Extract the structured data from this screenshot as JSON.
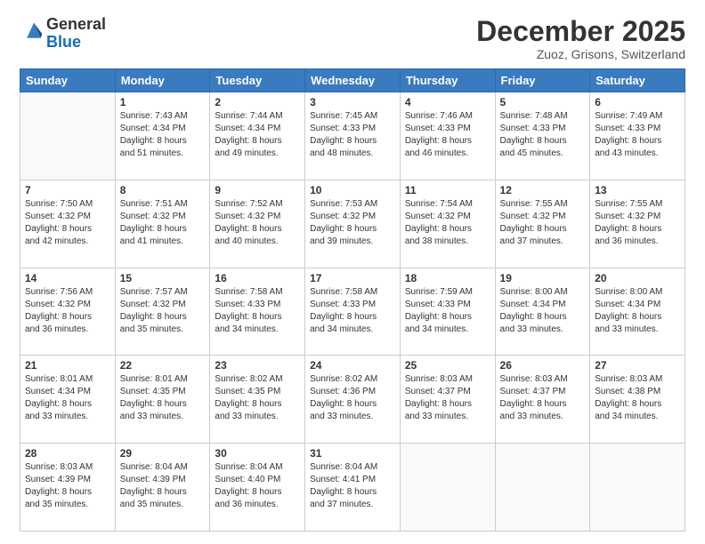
{
  "logo": {
    "general": "General",
    "blue": "Blue"
  },
  "header": {
    "month": "December 2025",
    "location": "Zuoz, Grisons, Switzerland"
  },
  "weekdays": [
    "Sunday",
    "Monday",
    "Tuesday",
    "Wednesday",
    "Thursday",
    "Friday",
    "Saturday"
  ],
  "weeks": [
    [
      {
        "day": "",
        "info": ""
      },
      {
        "day": "1",
        "info": "Sunrise: 7:43 AM\nSunset: 4:34 PM\nDaylight: 8 hours\nand 51 minutes."
      },
      {
        "day": "2",
        "info": "Sunrise: 7:44 AM\nSunset: 4:34 PM\nDaylight: 8 hours\nand 49 minutes."
      },
      {
        "day": "3",
        "info": "Sunrise: 7:45 AM\nSunset: 4:33 PM\nDaylight: 8 hours\nand 48 minutes."
      },
      {
        "day": "4",
        "info": "Sunrise: 7:46 AM\nSunset: 4:33 PM\nDaylight: 8 hours\nand 46 minutes."
      },
      {
        "day": "5",
        "info": "Sunrise: 7:48 AM\nSunset: 4:33 PM\nDaylight: 8 hours\nand 45 minutes."
      },
      {
        "day": "6",
        "info": "Sunrise: 7:49 AM\nSunset: 4:33 PM\nDaylight: 8 hours\nand 43 minutes."
      }
    ],
    [
      {
        "day": "7",
        "info": "Sunrise: 7:50 AM\nSunset: 4:32 PM\nDaylight: 8 hours\nand 42 minutes."
      },
      {
        "day": "8",
        "info": "Sunrise: 7:51 AM\nSunset: 4:32 PM\nDaylight: 8 hours\nand 41 minutes."
      },
      {
        "day": "9",
        "info": "Sunrise: 7:52 AM\nSunset: 4:32 PM\nDaylight: 8 hours\nand 40 minutes."
      },
      {
        "day": "10",
        "info": "Sunrise: 7:53 AM\nSunset: 4:32 PM\nDaylight: 8 hours\nand 39 minutes."
      },
      {
        "day": "11",
        "info": "Sunrise: 7:54 AM\nSunset: 4:32 PM\nDaylight: 8 hours\nand 38 minutes."
      },
      {
        "day": "12",
        "info": "Sunrise: 7:55 AM\nSunset: 4:32 PM\nDaylight: 8 hours\nand 37 minutes."
      },
      {
        "day": "13",
        "info": "Sunrise: 7:55 AM\nSunset: 4:32 PM\nDaylight: 8 hours\nand 36 minutes."
      }
    ],
    [
      {
        "day": "14",
        "info": "Sunrise: 7:56 AM\nSunset: 4:32 PM\nDaylight: 8 hours\nand 36 minutes."
      },
      {
        "day": "15",
        "info": "Sunrise: 7:57 AM\nSunset: 4:32 PM\nDaylight: 8 hours\nand 35 minutes."
      },
      {
        "day": "16",
        "info": "Sunrise: 7:58 AM\nSunset: 4:33 PM\nDaylight: 8 hours\nand 34 minutes."
      },
      {
        "day": "17",
        "info": "Sunrise: 7:58 AM\nSunset: 4:33 PM\nDaylight: 8 hours\nand 34 minutes."
      },
      {
        "day": "18",
        "info": "Sunrise: 7:59 AM\nSunset: 4:33 PM\nDaylight: 8 hours\nand 34 minutes."
      },
      {
        "day": "19",
        "info": "Sunrise: 8:00 AM\nSunset: 4:34 PM\nDaylight: 8 hours\nand 33 minutes."
      },
      {
        "day": "20",
        "info": "Sunrise: 8:00 AM\nSunset: 4:34 PM\nDaylight: 8 hours\nand 33 minutes."
      }
    ],
    [
      {
        "day": "21",
        "info": "Sunrise: 8:01 AM\nSunset: 4:34 PM\nDaylight: 8 hours\nand 33 minutes."
      },
      {
        "day": "22",
        "info": "Sunrise: 8:01 AM\nSunset: 4:35 PM\nDaylight: 8 hours\nand 33 minutes."
      },
      {
        "day": "23",
        "info": "Sunrise: 8:02 AM\nSunset: 4:35 PM\nDaylight: 8 hours\nand 33 minutes."
      },
      {
        "day": "24",
        "info": "Sunrise: 8:02 AM\nSunset: 4:36 PM\nDaylight: 8 hours\nand 33 minutes."
      },
      {
        "day": "25",
        "info": "Sunrise: 8:03 AM\nSunset: 4:37 PM\nDaylight: 8 hours\nand 33 minutes."
      },
      {
        "day": "26",
        "info": "Sunrise: 8:03 AM\nSunset: 4:37 PM\nDaylight: 8 hours\nand 33 minutes."
      },
      {
        "day": "27",
        "info": "Sunrise: 8:03 AM\nSunset: 4:38 PM\nDaylight: 8 hours\nand 34 minutes."
      }
    ],
    [
      {
        "day": "28",
        "info": "Sunrise: 8:03 AM\nSunset: 4:39 PM\nDaylight: 8 hours\nand 35 minutes."
      },
      {
        "day": "29",
        "info": "Sunrise: 8:04 AM\nSunset: 4:39 PM\nDaylight: 8 hours\nand 35 minutes."
      },
      {
        "day": "30",
        "info": "Sunrise: 8:04 AM\nSunset: 4:40 PM\nDaylight: 8 hours\nand 36 minutes."
      },
      {
        "day": "31",
        "info": "Sunrise: 8:04 AM\nSunset: 4:41 PM\nDaylight: 8 hours\nand 37 minutes."
      },
      {
        "day": "",
        "info": ""
      },
      {
        "day": "",
        "info": ""
      },
      {
        "day": "",
        "info": ""
      }
    ]
  ]
}
